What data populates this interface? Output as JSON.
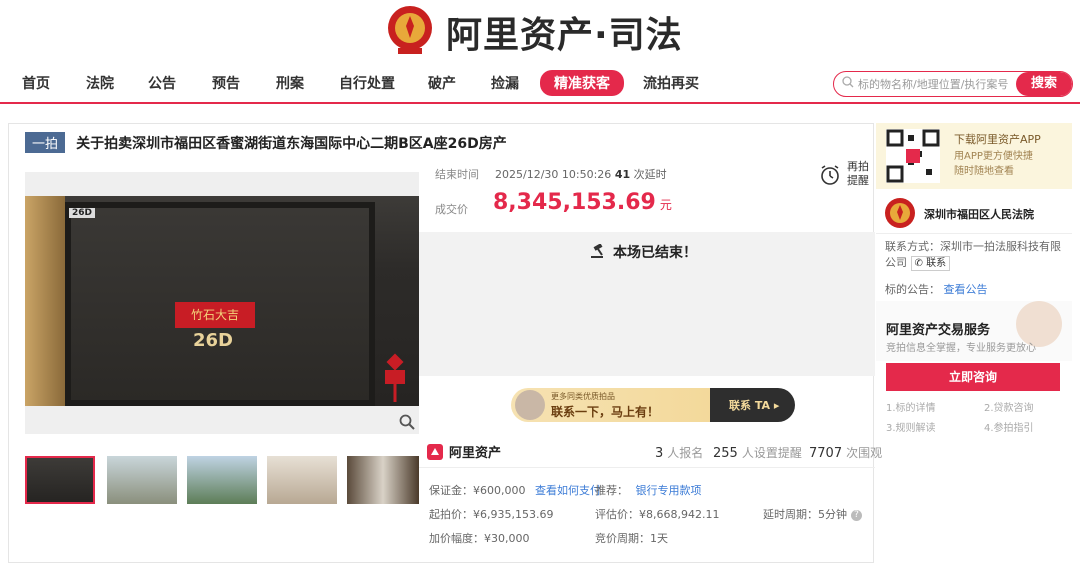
{
  "brand": {
    "name": "阿里资产·司法"
  },
  "nav": {
    "items": [
      "首页",
      "法院",
      "公告",
      "预告",
      "刑案",
      "自行处置",
      "破产",
      "捡漏",
      "精准获客",
      "流拍再买"
    ],
    "active_index": 8,
    "search_placeholder": "标的物名称/地理位置/执行案号",
    "search_button": "搜索"
  },
  "item": {
    "round_badge": "一拍",
    "title": "关于拍卖深圳市福田区香蜜湖街道东海国际中心二期B区A座26D房产",
    "photo_sign": "26D",
    "photo_red_text": "竹石大吉",
    "photo_door_number": "26D"
  },
  "auction": {
    "end_label": "结束时间",
    "end_time": "2025/12/30 10:50:26",
    "delay_count": "41",
    "delay_label": "次延时",
    "remind_line1": "再拍",
    "remind_line2": "提醒",
    "price_label": "成交价",
    "price": "8,345,153.69",
    "price_unit": "元",
    "ended_text": "本场已结束！"
  },
  "banner": {
    "line1": "更多同类优质拍品",
    "line2": "联系一下，马上有！",
    "cta": "联系 TA ▸"
  },
  "stats": {
    "brand": "阿里资产",
    "signups": "3",
    "signups_label": "人报名",
    "reminders": "255",
    "reminders_label": "人设置提醒",
    "views": "7707",
    "views_label": "次围观"
  },
  "details": {
    "deposit": "保证金：¥600,000",
    "deposit_link": "查看如何支付",
    "recommend_label": "推荐：",
    "recommend_link": "银行专用款项",
    "start_price": "起拍价：¥6,935,153.69",
    "assess_price": "评估价：¥8,668,942.11",
    "delay_period": "延时周期：5分钟",
    "increment": "加价幅度：¥30,000",
    "bid_period": "竞价周期：1天"
  },
  "sidebar": {
    "app_title": "下载阿里资产APP",
    "app_sub1": "用APP更方便快捷",
    "app_sub2": "随时随地查看",
    "court_name": "深圳市福田区人民法院",
    "contact_label": "联系方式：",
    "contact_value": "深圳市一拍法服科技有限公司",
    "contact_btn": "联系",
    "notice_label": "标的公告：",
    "notice_link": "查看公告",
    "service_title": "阿里资产交易服务",
    "service_sub": "竞拍信息全掌握，专业服务更放心",
    "consult_button": "立即咨询",
    "steps": [
      "1.标的详情",
      "2.贷款咨询",
      "3.规则解读",
      "4.参拍指引"
    ]
  },
  "colors": {
    "accent": "#e4294b",
    "link": "#3b7bd6",
    "badge": "#4c6a93"
  }
}
